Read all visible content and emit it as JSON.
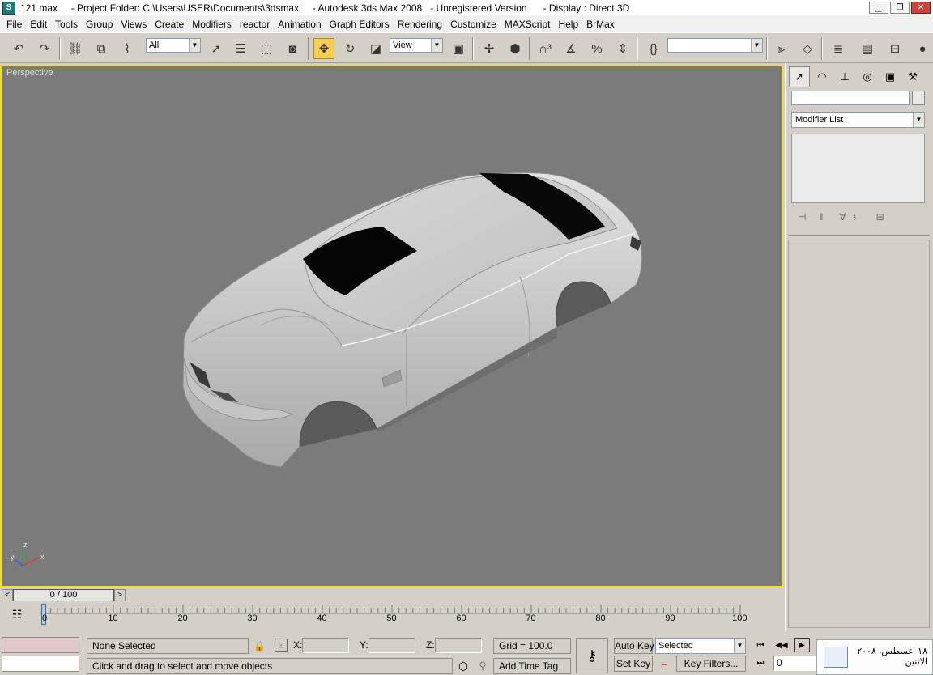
{
  "window": {
    "app_icon_letter": "S",
    "title": "121.max     - Project Folder: C:\\Users\\USER\\Documents\\3dsmax     - Autodesk 3ds Max 2008   - Unregistered Version      - Display : Direct 3D",
    "minimize_glyph": "▁",
    "maximize_glyph": "❐",
    "close_glyph": "✕"
  },
  "menu": [
    "File",
    "Edit",
    "Tools",
    "Group",
    "Views",
    "Create",
    "Modifiers",
    "reactor",
    "Animation",
    "Graph Editors",
    "Rendering",
    "Customize",
    "MAXScript",
    "Help",
    "BrMax"
  ],
  "toolbar": {
    "selection_filter": "All",
    "reference_coord": "View",
    "named_selection": "",
    "active_tool": "select-and-move"
  },
  "viewport": {
    "label": "Perspective",
    "background": "#7b7b7b",
    "border_color": "#f0e11c",
    "axis_labels": {
      "x": "x",
      "y": "y",
      "z": "z"
    }
  },
  "command_panel": {
    "object_name": "",
    "modifier_list": "Modifier List"
  },
  "time_slider": {
    "position_text": "0 / 100",
    "prev": "<",
    "next": ">",
    "current_frame": 0,
    "total_frames": 100,
    "ticks": [
      "0",
      "10",
      "20",
      "30",
      "40",
      "50",
      "60",
      "70",
      "80",
      "90",
      "100"
    ]
  },
  "status": {
    "selection": "None Selected",
    "prompt": "Click and drag to select and move objects",
    "x_label": "X:",
    "y_label": "Y:",
    "z_label": "Z:",
    "x_value": "",
    "y_value": "",
    "z_value": "",
    "grid": "Grid = 100.0",
    "add_time_tag": "Add Time Tag",
    "auto_key": "Auto Key",
    "set_key": "Set Key",
    "selected_option": "Selected",
    "key_filters": "Key Filters...",
    "frame_field": "0"
  },
  "taskbar_popup": {
    "line1": "١٨ اغسطس، ٢٠٠٨",
    "line2": "الاثنين"
  }
}
